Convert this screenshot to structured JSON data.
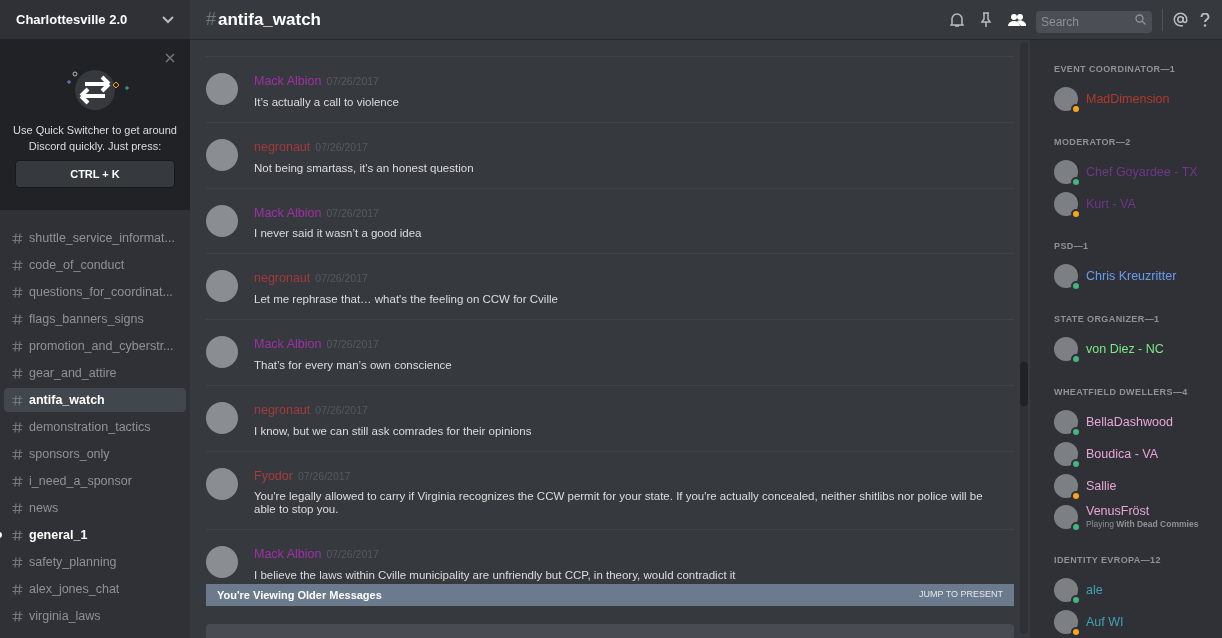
{
  "server": {
    "name": "Charlottesville 2.0"
  },
  "quick_switcher": {
    "text": "Use Quick Switcher to get around Discord quickly. Just press:",
    "shortcut": "CTRL + K"
  },
  "channels": [
    {
      "name": "shuttle_service_informat...",
      "selected": false,
      "unread": false
    },
    {
      "name": "code_of_conduct",
      "selected": false,
      "unread": false
    },
    {
      "name": "questions_for_coordinat...",
      "selected": false,
      "unread": false
    },
    {
      "name": "flags_banners_signs",
      "selected": false,
      "unread": false
    },
    {
      "name": "promotion_and_cyberstr...",
      "selected": false,
      "unread": false
    },
    {
      "name": "gear_and_attire",
      "selected": false,
      "unread": false
    },
    {
      "name": "antifa_watch",
      "selected": true,
      "unread": false
    },
    {
      "name": "demonstration_tactics",
      "selected": false,
      "unread": false
    },
    {
      "name": "sponsors_only",
      "selected": false,
      "unread": false
    },
    {
      "name": "i_need_a_sponsor",
      "selected": false,
      "unread": false
    },
    {
      "name": "news",
      "selected": false,
      "unread": false
    },
    {
      "name": "general_1",
      "selected": false,
      "unread": true
    },
    {
      "name": "safety_planning",
      "selected": false,
      "unread": false
    },
    {
      "name": "alex_jones_chat",
      "selected": false,
      "unread": false
    },
    {
      "name": "virginia_laws",
      "selected": false,
      "unread": false
    }
  ],
  "channel_header": {
    "hash": "#",
    "name": "antifa_watch",
    "search_placeholder": "Search"
  },
  "messages": [
    {
      "author": "Mack Albion",
      "color": "#a12fa8",
      "time": "07/26/2017",
      "text": "It’s actually a call to violence"
    },
    {
      "author": "negronaut",
      "color": "#a33a3a",
      "time": "07/26/2017",
      "text": "Not being smartass, it's an honest question"
    },
    {
      "author": "Mack Albion",
      "color": "#a12fa8",
      "time": "07/26/2017",
      "text": "I never said it wasn’t a good idea"
    },
    {
      "author": "negronaut",
      "color": "#a33a3a",
      "time": "07/26/2017",
      "text": "Let me rephrase that… what's the feeling on CCW for Cville"
    },
    {
      "author": "Mack Albion",
      "color": "#a12fa8",
      "time": "07/26/2017",
      "text": "That’s for every man’s own conscience"
    },
    {
      "author": "negronaut",
      "color": "#a33a3a",
      "time": "07/26/2017",
      "text": "I know, but we can still ask comrades for their opinions"
    },
    {
      "author": "Fyodor",
      "color": "#a83c3c",
      "time": "07/26/2017",
      "text": "You're legally allowed to carry if Virginia recognizes the CCW permit for your state. If you're actually concealed, neither shitlibs nor police will be able to stop you."
    },
    {
      "author": "Mack Albion",
      "color": "#a12fa8",
      "time": "07/26/2017",
      "text": "I believe the laws within Cville municipality are unfriendly but CCP, in theory, would contradict it"
    }
  ],
  "older_messages_bar": {
    "text": "You're Viewing Older Messages",
    "action": "JUMP TO PRESENT"
  },
  "member_groups": [
    {
      "title": "EVENT COORDINATOR—1",
      "members": [
        {
          "name": "MadDimension",
          "color": "#b03a2e",
          "idle": true
        }
      ]
    },
    {
      "title": "MODERATOR—2",
      "members": [
        {
          "name": "Chef Goyardee - TX",
          "color": "#71368a",
          "idle": false
        },
        {
          "name": "Kurt - VA",
          "color": "#71368a",
          "idle": true
        }
      ]
    },
    {
      "title": "PSD—1",
      "members": [
        {
          "name": "Chris Kreuzritter",
          "color": "#6b9cf0",
          "idle": false
        }
      ]
    },
    {
      "title": "STATE ORGANIZER—1",
      "members": [
        {
          "name": "von Diez - NC",
          "color": "#7ee787",
          "idle": false
        }
      ]
    },
    {
      "title": "WHEATFIELD DWELLERS—4",
      "members": [
        {
          "name": "BellaDashwood",
          "color": "#e8a6d8",
          "idle": false
        },
        {
          "name": "Boudica - VA",
          "color": "#e8a6d8",
          "idle": false
        },
        {
          "name": "Sallie",
          "color": "#e8a6d8",
          "idle": true
        },
        {
          "name": "VenusFröst",
          "color": "#e8a6d8",
          "idle": false,
          "activity": "Playing **With Dead Commies**"
        }
      ]
    },
    {
      "title": "IDENTITY EVROPA—12",
      "members": [
        {
          "name": "ale",
          "color": "#3fa3b0",
          "idle": false
        },
        {
          "name": "Auf WI",
          "color": "#3fa3b0",
          "idle": true
        }
      ]
    }
  ]
}
